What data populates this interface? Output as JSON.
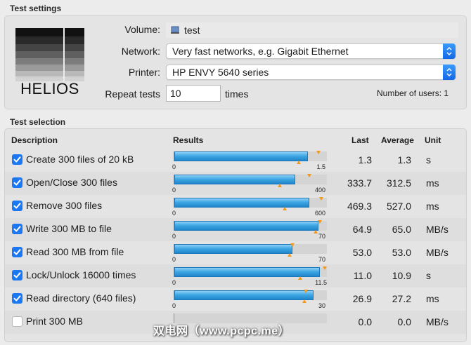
{
  "settings": {
    "title": "Test settings",
    "logo_text": "HELIOS",
    "volume_label": "Volume:",
    "volume_value": "test",
    "network_label": "Network:",
    "network_value": "Very fast networks, e.g. Gigabit Ethernet",
    "printer_label": "Printer:",
    "printer_value": "HP ENVY 5640 series",
    "repeat_label": "Repeat tests",
    "repeat_value": "10",
    "repeat_unit": "times",
    "users_text": "Number of users: 1"
  },
  "selection": {
    "title": "Test selection",
    "col_description": "Description",
    "col_results": "Results",
    "col_last": "Last",
    "col_average": "Average",
    "col_unit": "Unit",
    "rows": [
      {
        "checked": true,
        "label": "Create 300 files of 20 kB",
        "min": "0",
        "max": "1.5",
        "fill": 0.87,
        "avg_marker": 0.94,
        "last_marker": 0.81,
        "last": "1.3",
        "average": "1.3",
        "unit": "s"
      },
      {
        "checked": true,
        "label": "Open/Close 300 files",
        "min": "0",
        "max": "400",
        "fill": 0.79,
        "avg_marker": 0.88,
        "last_marker": 0.69,
        "last": "333.7",
        "average": "312.5",
        "unit": "ms"
      },
      {
        "checked": true,
        "label": "Remove 300 files",
        "min": "0",
        "max": "600",
        "fill": 0.88,
        "avg_marker": 0.96,
        "last_marker": 0.72,
        "last": "469.3",
        "average": "527.0",
        "unit": "ms"
      },
      {
        "checked": true,
        "label": "Write 300 MB to file",
        "min": "0",
        "max": "70",
        "fill": 0.94,
        "avg_marker": 0.95,
        "last_marker": 0.92,
        "last": "64.9",
        "average": "65.0",
        "unit": "MB/s"
      },
      {
        "checked": true,
        "label": "Read 300 MB from file",
        "min": "0",
        "max": "70",
        "fill": 0.77,
        "avg_marker": 0.77,
        "last_marker": 0.75,
        "last": "53.0",
        "average": "53.0",
        "unit": "MB/s"
      },
      {
        "checked": true,
        "label": "Lock/Unlock 16000 times",
        "min": "0",
        "max": "11.5",
        "fill": 0.95,
        "avg_marker": 0.98,
        "last_marker": 0.82,
        "last": "11.0",
        "average": "10.9",
        "unit": "s"
      },
      {
        "checked": true,
        "label": "Read directory (640 files)",
        "min": "0",
        "max": "30",
        "fill": 0.91,
        "avg_marker": 0.86,
        "last_marker": 0.85,
        "last": "26.9",
        "average": "27.2",
        "unit": "ms"
      },
      {
        "checked": false,
        "label": "Print 300 MB",
        "min": "",
        "max": "",
        "fill": 0,
        "avg_marker": null,
        "last_marker": null,
        "last": "0.0",
        "average": "0.0",
        "unit": "MB/s"
      }
    ]
  },
  "watermark": "双电网（www.pcpc.me）",
  "colors": {
    "accent": "#1b78f2",
    "bar": "#3fa7e4",
    "marker": "#f39a1c"
  }
}
